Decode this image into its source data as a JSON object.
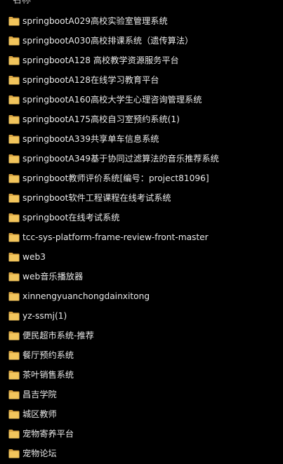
{
  "header": {
    "name_label": "名称"
  },
  "colors": {
    "folder_back": "#d9a441",
    "folder_front": "#f2c55c",
    "text": "#e8e8e8",
    "background": "#000000"
  },
  "icon": "folder-icon",
  "items": [
    {
      "label": "springbootA029高校实验室管理系统"
    },
    {
      "label": "springbootA030高校排课系统（遗传算法）"
    },
    {
      "label": "springbootA128 高校教学资源服务平台"
    },
    {
      "label": "springbootA128在线学习教育平台"
    },
    {
      "label": "springbootA160高校大学生心理咨询管理系统"
    },
    {
      "label": "springbootA175高校自习室预约系统(1)"
    },
    {
      "label": "springbootA339共享单车信息系统"
    },
    {
      "label": "springbootA349基于协同过滤算法的音乐推荐系统"
    },
    {
      "label": "springboot教师评价系统[编号：project81096]"
    },
    {
      "label": "springboot软件工程课程在线考试系统"
    },
    {
      "label": "springboot在线考试系统"
    },
    {
      "label": "tcc-sys-platform-frame-review-front-master"
    },
    {
      "label": "web3"
    },
    {
      "label": "web音乐播放器"
    },
    {
      "label": "xinnengyuanchongdainxitong"
    },
    {
      "label": "yz-ssmj(1)"
    },
    {
      "label": "便民超市系统-推荐"
    },
    {
      "label": "餐厅预约系统"
    },
    {
      "label": "茶叶销售系统"
    },
    {
      "label": "昌吉学院"
    },
    {
      "label": "城区教师"
    },
    {
      "label": "宠物寄养平台"
    },
    {
      "label": "宠物论坛"
    }
  ]
}
